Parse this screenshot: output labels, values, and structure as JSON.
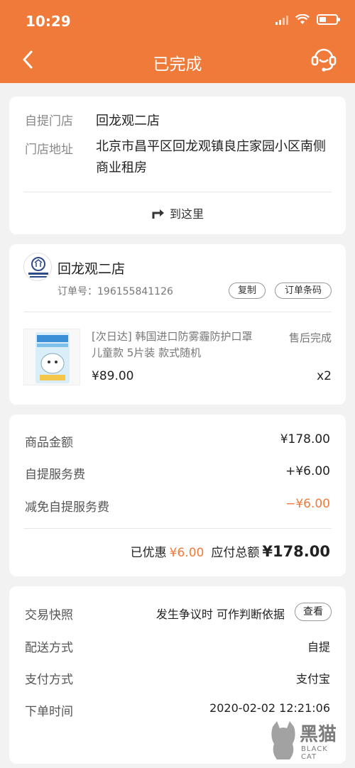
{
  "status_bar": {
    "time": "10:29"
  },
  "nav": {
    "title": "已完成"
  },
  "pickup": {
    "store_label": "自提门店",
    "store_value": "回龙观二店",
    "address_label": "门店地址",
    "address_value": "北京市昌平区回龙观镇良庄家园小区南侧商业租房",
    "navigate_label": "到这里"
  },
  "order": {
    "store_name": "回龙观二店",
    "order_no": "订单号：196155841126",
    "copy_label": "复制",
    "barcode_label": "订单条码",
    "product": {
      "name": "[次日达] 韩国进口防雾霾防护口罩儿童款 5片装 款式随机",
      "status": "售后完成",
      "price": "¥89.00",
      "qty": "x2"
    }
  },
  "amounts": {
    "goods_label": "商品金额",
    "goods_value": "¥178.00",
    "fee_label": "自提服务费",
    "fee_value": "+¥6.00",
    "discount_label": "减免自提服务费",
    "discount_value": "−¥6.00",
    "saved_label": "已优惠",
    "saved_value": "¥6.00",
    "total_label": "应付总额",
    "total_value": "¥178.00"
  },
  "info": {
    "snapshot_label": "交易快照",
    "snapshot_text": "发生争议时 可作判断依据",
    "snapshot_btn": "查看",
    "delivery_label": "配送方式",
    "delivery_value": "自提",
    "payment_label": "支付方式",
    "payment_value": "支付宝",
    "time_label": "下单时间",
    "time_value": "2020-02-02 12:21:06"
  },
  "watermark": {
    "text": "黑猫",
    "sub": "BLACK CAT"
  },
  "colors": {
    "accent": "#f07a3a"
  }
}
